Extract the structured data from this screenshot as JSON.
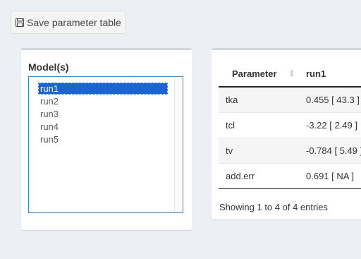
{
  "toolbar": {
    "save_label": "Save parameter table",
    "save_icon": "floppy-disk-icon"
  },
  "models": {
    "label": "Model(s)",
    "options": [
      "run1",
      "run2",
      "run3",
      "run4",
      "run5"
    ],
    "selected": "run1"
  },
  "table": {
    "headers": [
      "Parameter",
      "run1"
    ],
    "rows": [
      [
        "tka",
        "0.455 [ 43.3 ]"
      ],
      [
        "tcl",
        "-3.22 [ 2.49 ]"
      ],
      [
        "tv",
        "-0.784 [ 5.49 ]"
      ],
      [
        "add.err",
        "0.691 [ NA ]"
      ]
    ],
    "info": "Showing 1 to 4 of 4 entries"
  },
  "colors": {
    "accent": "#3c8dbc",
    "selected_bg": "#1c64d1",
    "page_bg": "#ecf0f5"
  }
}
